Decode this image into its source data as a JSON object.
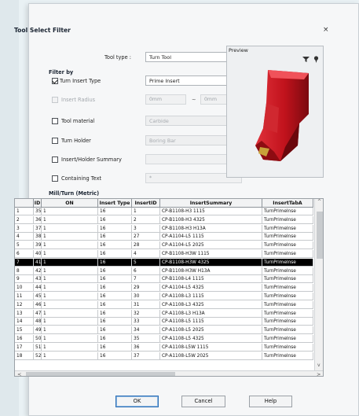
{
  "dialog": {
    "title": "Tool Select Filter",
    "close_glyph": "×"
  },
  "tool_type": {
    "label": "Tool type :",
    "value": "Turn Tool"
  },
  "filter_by": {
    "title": "Filter by",
    "turn_insert_type": {
      "label": "Turn Insert Type",
      "checked": true,
      "value": "Prime Insert"
    },
    "insert_radius": {
      "label": "Insert Radius",
      "checked": false,
      "from": "0mm",
      "separator": "~",
      "to": "0mm"
    },
    "tool_material": {
      "label": "Tool material",
      "checked": false,
      "value": "Carbide"
    },
    "turn_holder": {
      "label": "Turn Holder",
      "checked": false,
      "value": "Boring Bar"
    },
    "insert_holder_summary": {
      "label": "Insert/Holder Summary",
      "checked": false,
      "value": ""
    },
    "containing_text": {
      "label": "Containing Text",
      "checked": false,
      "value": "*"
    }
  },
  "preview": {
    "label": "Preview",
    "filter_icon": "filter-icon",
    "settings_icon": "pin-icon"
  },
  "grid": {
    "title": "Mill/Turn (Metric)",
    "columns": [
      "",
      "ID",
      "ON",
      "Insert Type",
      "InsertID",
      "InsertSummary",
      "InsertTabA"
    ],
    "selected_row": 6,
    "rows": [
      [
        "1",
        "35",
        "1",
        "16",
        "1",
        "CP-B1108-H3 1115",
        "TurnPrimeInse"
      ],
      [
        "2",
        "36",
        "1",
        "16",
        "2",
        "CP-B1108-H3 4325",
        "TurnPrimeInse"
      ],
      [
        "3",
        "37",
        "1",
        "16",
        "3",
        "CP-B1108-H3 H13A",
        "TurnPrimeInse"
      ],
      [
        "4",
        "38",
        "1",
        "16",
        "27",
        "CP-A1104-L5 1115",
        "TurnPrimeInse"
      ],
      [
        "5",
        "39",
        "1",
        "16",
        "28",
        "CP-A1104-L5 2025",
        "TurnPrimeInse"
      ],
      [
        "6",
        "40",
        "1",
        "16",
        "4",
        "CP-B1108-H3W 1115",
        "TurnPrimeInse"
      ],
      [
        "7",
        "41",
        "1",
        "16",
        "5",
        "CP-B1108-H3W 4325",
        "TurnPrimeInse"
      ],
      [
        "8",
        "42",
        "1",
        "16",
        "6",
        "CP-B1108-H3W H13A",
        "TurnPrimeInse"
      ],
      [
        "9",
        "43",
        "1",
        "16",
        "7",
        "CP-B1108-L4 1115",
        "TurnPrimeInse"
      ],
      [
        "10",
        "44",
        "1",
        "16",
        "29",
        "CP-A1104-L5 4325",
        "TurnPrimeInse"
      ],
      [
        "11",
        "45",
        "1",
        "16",
        "30",
        "CP-A1108-L3 1115",
        "TurnPrimeInse"
      ],
      [
        "12",
        "46",
        "1",
        "16",
        "31",
        "CP-A1108-L3 4325",
        "TurnPrimeInse"
      ],
      [
        "13",
        "47",
        "1",
        "16",
        "32",
        "CP-A1108-L3 H13A",
        "TurnPrimeInse"
      ],
      [
        "14",
        "48",
        "1",
        "16",
        "33",
        "CP-A1108-L5 1115",
        "TurnPrimeInse"
      ],
      [
        "15",
        "49",
        "1",
        "16",
        "34",
        "CP-A1108-L5 2025",
        "TurnPrimeInse"
      ],
      [
        "16",
        "50",
        "1",
        "16",
        "35",
        "CP-A1108-L5 4325",
        "TurnPrimeInse"
      ],
      [
        "17",
        "51",
        "1",
        "16",
        "36",
        "CP-A1108-L5W 1115",
        "TurnPrimeInse"
      ],
      [
        "18",
        "52",
        "1",
        "16",
        "37",
        "CP-A1108-L5W 2025",
        "TurnPrimeInse"
      ]
    ]
  },
  "buttons": {
    "ok": "OK",
    "cancel": "Cancel",
    "help": "Help"
  },
  "scroll": {
    "left": "<",
    "right": ">",
    "up": "^",
    "down": "v"
  }
}
